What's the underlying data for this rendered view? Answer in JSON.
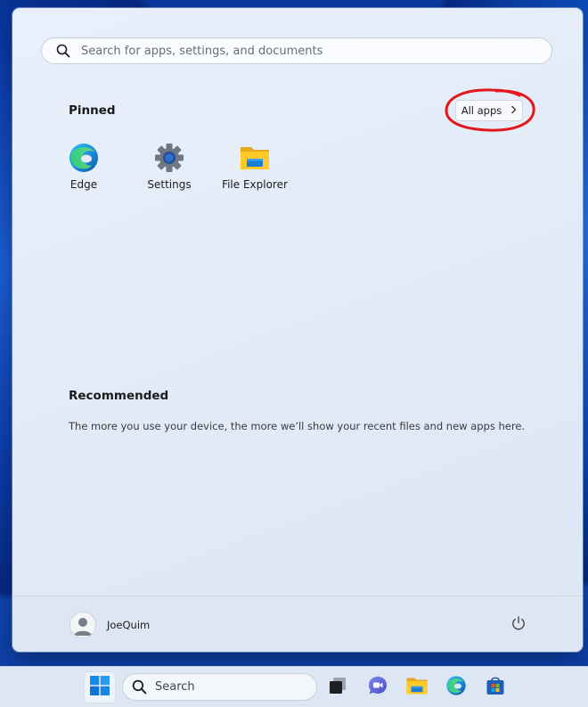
{
  "start_menu": {
    "search": {
      "placeholder": "Search for apps, settings, and documents"
    },
    "pinned": {
      "title": "Pinned",
      "all_apps_label": "All apps",
      "apps": [
        {
          "label": "Edge",
          "icon": "edge-icon"
        },
        {
          "label": "Settings",
          "icon": "gear-icon"
        },
        {
          "label": "File Explorer",
          "icon": "folder-icon"
        }
      ]
    },
    "recommended": {
      "title": "Recommended",
      "empty_text": "The more you use your device, the more we’ll show your recent files and new apps here."
    },
    "footer": {
      "user_name": "JoeQuim",
      "power_icon": "power-icon"
    }
  },
  "taskbar": {
    "search_label": "Search",
    "icons": [
      "windows-start-icon",
      "search-icon",
      "task-view-icon",
      "teams-chat-icon",
      "file-explorer-icon",
      "edge-icon",
      "store-icon"
    ]
  },
  "colors": {
    "annotation_ring": "#e3161e",
    "accent": "#0067c0"
  }
}
